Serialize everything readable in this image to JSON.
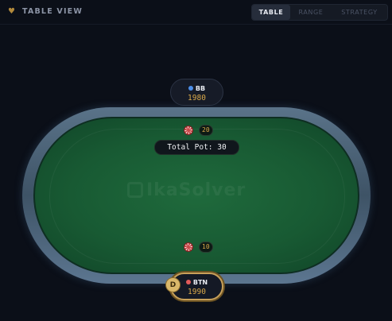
{
  "header": {
    "title": "TABLE VIEW",
    "icon": "heart-icon",
    "tabs": [
      {
        "label": "TABLE",
        "active": true
      },
      {
        "label": "RANGE",
        "active": false
      },
      {
        "label": "STRATEGY",
        "active": false
      }
    ]
  },
  "table": {
    "watermark": "IkaSolver",
    "pot_label": "Total Pot: 30",
    "felt_color": "#185a33"
  },
  "seats": [
    {
      "name": "BB",
      "stack": "1980",
      "dot_color": "#4c8ee8",
      "bet": "20"
    },
    {
      "name": "BTN",
      "stack": "1990",
      "dot_color": "#e25a5a",
      "bet": "10",
      "dealer": "D"
    }
  ]
}
